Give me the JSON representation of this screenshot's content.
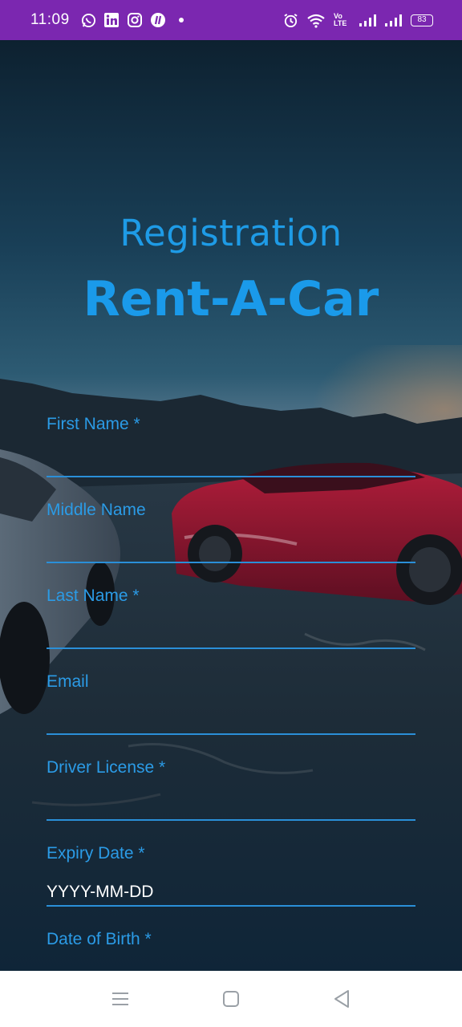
{
  "status_bar": {
    "time": "11:09",
    "left_icons": [
      "whatsapp-icon",
      "linkedin-icon",
      "instagram-icon",
      "app-icon"
    ],
    "right_icons": [
      "alarm-icon",
      "wifi-icon",
      "volte-icon",
      "signal-icon",
      "signal-icon"
    ],
    "volte_label": "Vo LTE",
    "battery_level": "83"
  },
  "header": {
    "subtitle": "Registration",
    "title": "Rent-A-Car"
  },
  "form": {
    "fields": [
      {
        "label": "First Name *",
        "value": "",
        "placeholder": ""
      },
      {
        "label": "Middle Name",
        "value": "",
        "placeholder": ""
      },
      {
        "label": "Last Name *",
        "value": "",
        "placeholder": ""
      },
      {
        "label": "Email",
        "value": "",
        "placeholder": ""
      },
      {
        "label": "Driver License *",
        "value": "",
        "placeholder": ""
      },
      {
        "label": "Expiry Date *",
        "value": "",
        "placeholder": "YYYY-MM-DD"
      },
      {
        "label": "Date of Birth *",
        "value": "",
        "placeholder": ""
      }
    ]
  },
  "nav_bar": {
    "buttons": [
      "menu-icon",
      "home-icon",
      "back-icon"
    ]
  },
  "colors": {
    "status_bar": "#7b27b0",
    "accent": "#1e9be6",
    "nav_bar": "#ffffff"
  }
}
